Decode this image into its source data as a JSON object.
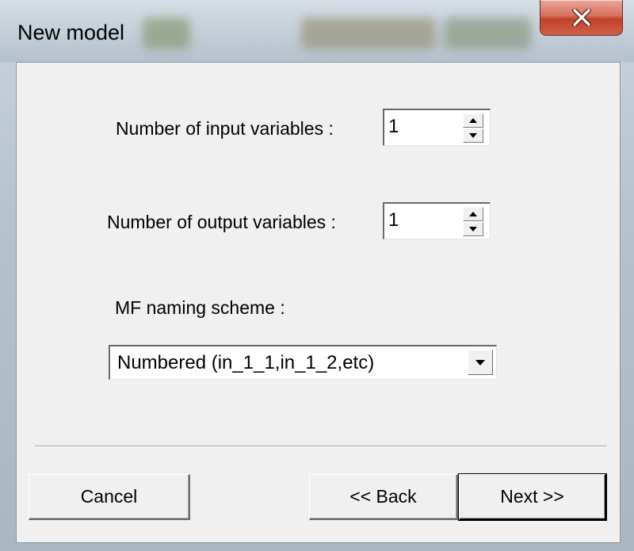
{
  "window": {
    "title": "New model",
    "close_label": "Close"
  },
  "form": {
    "input_vars": {
      "label": "Number of input variables :",
      "value": "1"
    },
    "output_vars": {
      "label": "Number of output variables :",
      "value": "1"
    },
    "mf_scheme": {
      "label": "MF naming scheme :",
      "selected": "Numbered (in_1_1,in_1_2,etc)"
    }
  },
  "buttons": {
    "cancel": "Cancel",
    "back": "<< Back",
    "next": "Next >>"
  },
  "icons": {
    "close": "close-icon",
    "spin_up": "arrow-up-icon",
    "spin_down": "arrow-down-icon",
    "dropdown": "chevron-down-icon"
  },
  "colors": {
    "dialog_bg": "#f0f0f0",
    "close_button": "#c1402a",
    "frame": "#b6c2cd"
  }
}
